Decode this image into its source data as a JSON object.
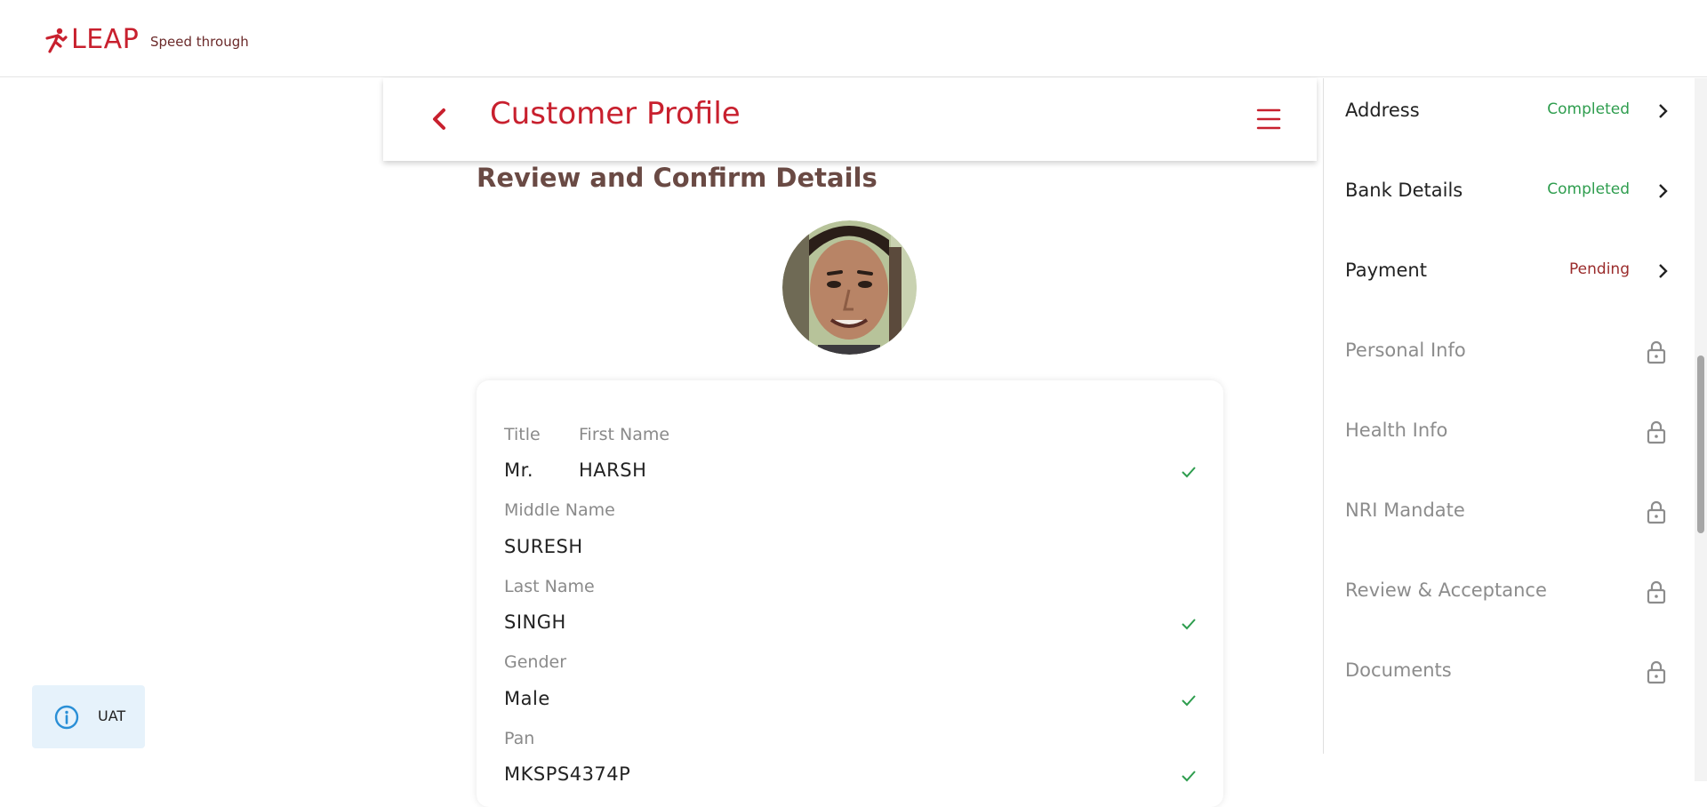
{
  "header": {
    "logo_text": "LEAP",
    "tagline": "Speed through"
  },
  "profile_header": {
    "title": "Customer Profile"
  },
  "main": {
    "section_title": "Review and Confirm Details",
    "fields": {
      "title_label": "Title",
      "title_value": "Mr.",
      "first_name_label": "First Name",
      "first_name_value": "HARSH",
      "middle_name_label": "Middle Name",
      "middle_name_value": "SURESH",
      "last_name_label": "Last Name",
      "last_name_value": "SINGH",
      "gender_label": "Gender",
      "gender_value": "Male",
      "pan_label": "Pan",
      "pan_value": "MKSPS4374P"
    }
  },
  "sidebar": {
    "items": [
      {
        "label": "Address",
        "status": "Completed",
        "state": "completed"
      },
      {
        "label": "Bank Details",
        "status": "Completed",
        "state": "completed"
      },
      {
        "label": "Payment",
        "status": "Pending",
        "state": "pending"
      },
      {
        "label": "Personal Info",
        "state": "locked"
      },
      {
        "label": "Health Info",
        "state": "locked"
      },
      {
        "label": "NRI Mandate",
        "state": "locked"
      },
      {
        "label": "Review & Acceptance",
        "state": "locked"
      },
      {
        "label": "Documents",
        "state": "locked"
      }
    ]
  },
  "env_badge": {
    "label": "UAT",
    "icon": "info-icon"
  },
  "colors": {
    "brand_red": "#c8202e",
    "completed_green": "#2e9d4e",
    "pending_red": "#9a2b2b",
    "uat_bg": "#e6f2fb"
  }
}
